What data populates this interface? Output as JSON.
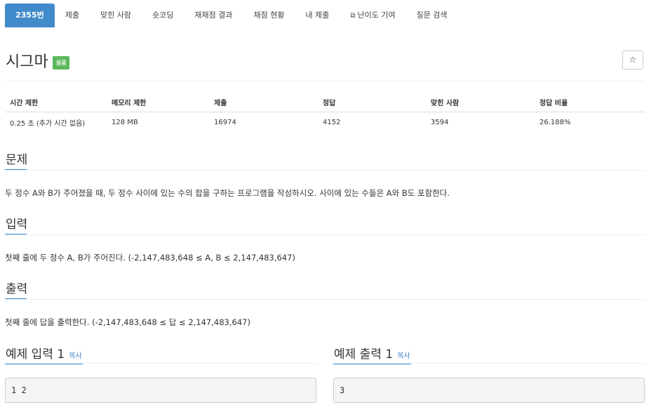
{
  "tabs": [
    {
      "label": "2355번",
      "active": true
    },
    {
      "label": "제출"
    },
    {
      "label": "맞힌 사람"
    },
    {
      "label": "숏코딩"
    },
    {
      "label": "재채점 결과"
    },
    {
      "label": "채점 현황"
    },
    {
      "label": "내 제출"
    },
    {
      "label": "난이도 기여",
      "icon": "external-link-icon"
    },
    {
      "label": "질문 검색"
    }
  ],
  "problem": {
    "title": "시그마",
    "badge": "성공",
    "star": "☆"
  },
  "info": {
    "headers": [
      "시간 제한",
      "메모리 제한",
      "제출",
      "정답",
      "맞힌 사람",
      "정답 비율"
    ],
    "values": [
      "0.25 초 (추가 시간 없음)",
      "128 MB",
      "16974",
      "4152",
      "3594",
      "26.188%"
    ]
  },
  "sections": {
    "description_title": "문제",
    "description": "두 정수 A와 B가 주어졌을 때, 두 정수 사이에 있는 수의 합을 구하는 프로그램을 작성하시오. 사이에 있는 수들은 A와 B도 포함한다.",
    "input_title": "입력",
    "input": "첫째 줄에 두 정수 A, B가 주어진다. (-2,147,483,648 ≤ A, B ≤ 2,147,483,647)",
    "output_title": "출력",
    "output": "첫째 줄에 답을 출력한다. (-2,147,483,648 ≤ 답 ≤ 2,147,483,647)"
  },
  "examples": {
    "input_title": "예제 입력 1",
    "output_title": "예제 출력 1",
    "copy_label": "복사",
    "input_value": "1 2",
    "output_value": "3"
  },
  "colors": {
    "accent": "#428bca",
    "success": "#5cb85c"
  }
}
